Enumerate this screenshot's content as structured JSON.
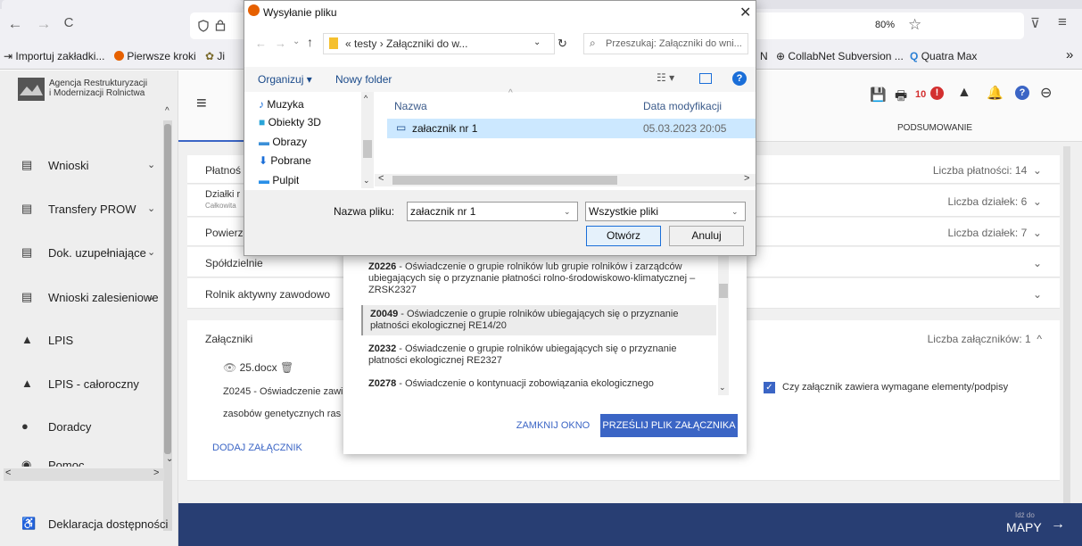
{
  "browser": {
    "nav": {
      "back": "←",
      "forward": "→",
      "reload": "C"
    },
    "zoom": "80%",
    "bookmarks": [
      {
        "label": "Importuj zakładki...",
        "icon": "import-icon"
      },
      {
        "label": "Pierwsze kroki",
        "icon": "firefox-icon"
      },
      {
        "label": "Ji",
        "icon": "bug-icon"
      },
      {
        "label": "N",
        "icon": ""
      },
      {
        "label": "CollabNet Subversion ...",
        "icon": "globe-icon"
      },
      {
        "label": "Quatra Max",
        "icon": "search-icon"
      }
    ],
    "overflow": "»"
  },
  "app": {
    "agency_name_line1": "Agencja Restrukturyzacji",
    "agency_name_line2": "i Modernizacji Rolnictwa",
    "sidebar": [
      {
        "label": "Wnioski",
        "icon": "document-icon",
        "chevron": "⌄"
      },
      {
        "label": "Transfery PROW",
        "icon": "document-icon",
        "chevron": "⌄"
      },
      {
        "label": "Dok. uzupełniające",
        "icon": "document-icon",
        "chevron": "⌄"
      },
      {
        "label": "Wnioski zalesieniowe",
        "icon": "document-icon",
        "chevron": "⌄"
      },
      {
        "label": "LPIS",
        "icon": "mountain-icon",
        "chevron": ""
      },
      {
        "label": "LPIS - całoroczny",
        "icon": "mountain-icon",
        "chevron": ""
      },
      {
        "label": "Doradcy",
        "icon": "person-icon",
        "chevron": ""
      },
      {
        "label": "Pomoc",
        "icon": "help-icon",
        "chevron": ""
      }
    ],
    "accessibility": "Deklaracja dostępności",
    "toolbar_badge": "10",
    "tab_summary": "PODSUMOWANIE",
    "panels": {
      "platnosci": {
        "title": "Płatnoś",
        "right": "Liczba płatności: 14"
      },
      "dzialki": {
        "title": "Działki r",
        "sub": "Całkowita",
        "right": "Liczba działek: 6"
      },
      "powierz": {
        "title": "Powierz",
        "right": "Liczba działek: 7"
      },
      "spoldzielnie": {
        "title": "Spółdzielnie"
      },
      "rolnik": {
        "title": "Rolnik aktywny zawodowo"
      },
      "zalaczniki": {
        "title": "Załączniki",
        "right": "Liczba załączników: 1",
        "file": "25.docx",
        "desc_line1": "Z0245 - Oświadczenie zawi",
        "desc_line2": "zasobów genetycznych ras",
        "checkbox_label": "Czy załącznik zawiera wymagane elementy/podpisy",
        "add": "DODAJ ZAŁĄCZNIK"
      }
    },
    "map_link": {
      "small": "Idź do",
      "big": "MAPY"
    }
  },
  "attach_dialog": {
    "items": [
      {
        "code": "Z0226",
        "text": " - Oświadczenie o grupie rolników lub grupie rolników i zarządców ubiegających się o przyznanie płatności rolno-środowiskowo-klimatycznej – ZRSK2327"
      },
      {
        "code": "Z0049",
        "text": " - Oświadczenie o grupie rolników ubiegających się o przyznanie płatności ekologicznej RE14/20"
      },
      {
        "code": "Z0232",
        "text": " - Oświadczenie o grupie rolników ubiegających się o przyznanie płatności ekologicznej RE2327"
      },
      {
        "code": "Z0278",
        "text": " - Oświadczenie o kontynuacji zobowiązania ekologicznego"
      }
    ],
    "close": "ZAMKNIJ OKNO",
    "upload": "PRZEŚLIJ PLIK ZAŁĄCZNIKA"
  },
  "file_dialog": {
    "title": "Wysyłanie pliku",
    "path": [
      "testy",
      "Załączniki do w..."
    ],
    "search_placeholder": "Przeszukaj: Załączniki do wni...",
    "organize": "Organizuj ▾",
    "new_folder": "Nowy folder",
    "tree": [
      "Muzyka",
      "Obiekty 3D",
      "Obrazy",
      "Pobrane",
      "Pulpit"
    ],
    "col_name": "Nazwa",
    "col_date": "Data modyfikacji",
    "files": [
      {
        "name": "załacznik nr 1",
        "date": "05.03.2023 20:05"
      }
    ],
    "filename_label": "Nazwa pliku:",
    "filename_value": "załacznik nr 1",
    "filter": "Wszystkie pliki",
    "open": "Otwórz",
    "cancel": "Anuluj"
  }
}
